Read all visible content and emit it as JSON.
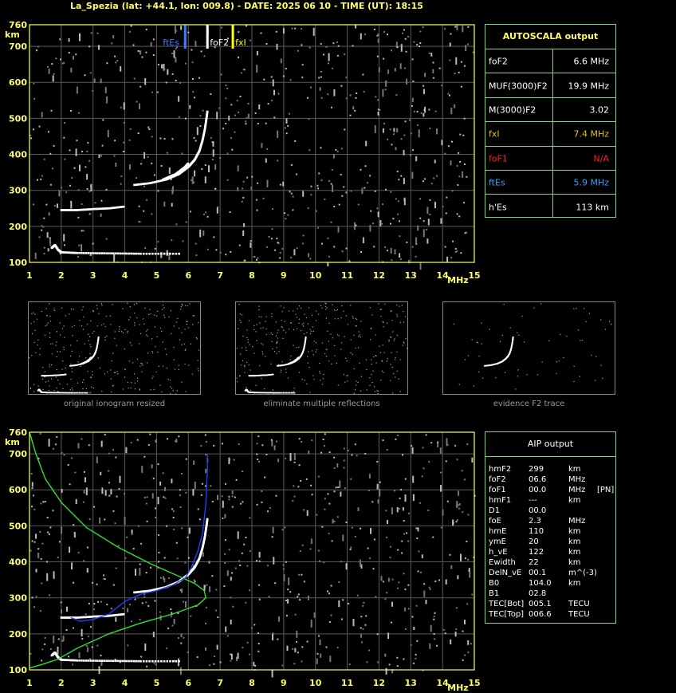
{
  "title": "La_Spezia (lat: +44.1, lon: 009.8) - DATE: 2025 06 10 - TIME (UT): 18:15",
  "colors": {
    "axis": "#ffff66",
    "grid": "#5a5a5a",
    "table_border": "#7fd37f",
    "fxI": "#ffff00",
    "ftEs": "#3a7fff",
    "foF1": "#ff2020",
    "trace": "#ffffff",
    "fit_blue": "#1f3fff",
    "fit_green": "#33dd33"
  },
  "autoscala": {
    "header": "AUTOSCALA output",
    "rows": [
      {
        "label": "foF2",
        "value": "6.6 MHz",
        "color": "#ffffff"
      },
      {
        "label": "MUF(3000)F2",
        "value": "19.9 MHz",
        "color": "#ffffff"
      },
      {
        "label": "M(3000)F2",
        "value": "3.02",
        "color": "#ffffff"
      },
      {
        "label": "fxI",
        "value": "7.4 MHz",
        "color": "#e0c020"
      },
      {
        "label": "foF1",
        "value": "N/A",
        "color": "#ff2020"
      },
      {
        "label": "ftEs",
        "value": "5.9 MHz",
        "color": "#3a9fff"
      },
      {
        "label": "h'Es",
        "value": "113    km",
        "color": "#ffffff"
      }
    ]
  },
  "chart_data": [
    {
      "type": "scatter",
      "name": "ionogram-autoscala",
      "xlim": [
        1,
        15
      ],
      "ylim": [
        100,
        760
      ],
      "x_ticks": [
        "1",
        "2",
        "3",
        "4",
        "5",
        "6",
        "7",
        "8",
        "9",
        "10",
        "11",
        "12",
        "13",
        "14",
        "15"
      ],
      "y_ticks": [
        "100",
        "200",
        "300",
        "400",
        "500",
        "600",
        "700",
        "760"
      ],
      "xunit": "MHz",
      "yunit": "km",
      "markers": [
        {
          "label": "ftEs",
          "x": 5.9,
          "color": "#3a7fff"
        },
        {
          "label": "foF2",
          "x": 6.6,
          "color": "#ffffff"
        },
        {
          "label": "fxI",
          "x": 7.4,
          "color": "#ffff00"
        }
      ],
      "traces": {
        "es_trace": [
          [
            1.7,
            140
          ],
          [
            1.8,
            148
          ],
          [
            1.9,
            135
          ],
          [
            2.0,
            128
          ],
          [
            2.5,
            126
          ],
          [
            3.5,
            125
          ],
          [
            4.5,
            124
          ],
          [
            5.8,
            124
          ]
        ],
        "es_multiple": [
          [
            2.0,
            245
          ],
          [
            2.5,
            245
          ],
          [
            3.0,
            248
          ],
          [
            3.5,
            250
          ],
          [
            4.0,
            255
          ]
        ],
        "f2_trace": [
          [
            4.3,
            315
          ],
          [
            4.8,
            320
          ],
          [
            5.3,
            330
          ],
          [
            5.7,
            345
          ],
          [
            6.0,
            365
          ],
          [
            6.2,
            385
          ],
          [
            6.35,
            410
          ],
          [
            6.45,
            440
          ],
          [
            6.52,
            470
          ],
          [
            6.57,
            500
          ],
          [
            6.6,
            520
          ]
        ],
        "f2_x_trace": [
          [
            5.2,
            330
          ],
          [
            5.6,
            345
          ],
          [
            5.9,
            365
          ],
          [
            6.0,
            375
          ]
        ]
      }
    },
    {
      "type": "line",
      "name": "ionogram-aip",
      "xlim": [
        1,
        15
      ],
      "ylim": [
        100,
        760
      ],
      "x_ticks": [
        "1",
        "2",
        "3",
        "4",
        "5",
        "6",
        "7",
        "8",
        "9",
        "10",
        "11",
        "12",
        "13",
        "14",
        "15"
      ],
      "y_ticks": [
        "100",
        "200",
        "300",
        "400",
        "500",
        "600",
        "700",
        "760"
      ],
      "xunit": "MHz",
      "yunit": "km",
      "series": [
        {
          "color": "#33dd33",
          "points": [
            [
              1,
              760
            ],
            [
              1.2,
              700
            ],
            [
              1.5,
              630
            ],
            [
              2.0,
              565
            ],
            [
              2.8,
              495
            ],
            [
              3.8,
              440
            ],
            [
              4.8,
              395
            ],
            [
              5.7,
              360
            ],
            [
              6.2,
              340
            ],
            [
              6.5,
              320
            ],
            [
              6.55,
              300
            ],
            [
              6.3,
              280
            ],
            [
              5.5,
              255
            ],
            [
              4.5,
              230
            ],
            [
              3.5,
              200
            ],
            [
              2.5,
              160
            ],
            [
              1.9,
              130
            ],
            [
              1.4,
              115
            ],
            [
              1,
              105
            ]
          ]
        },
        {
          "color": "#1f3fff",
          "points": [
            [
              2.3,
              245
            ],
            [
              2.6,
              235
            ],
            [
              3.0,
              240
            ],
            [
              3.5,
              255
            ],
            [
              4.0,
              290
            ],
            [
              4.5,
              310
            ],
            [
              5.0,
              320
            ],
            [
              5.5,
              335
            ],
            [
              5.9,
              355
            ],
            [
              6.1,
              385
            ],
            [
              6.3,
              430
            ],
            [
              6.45,
              480
            ],
            [
              6.55,
              560
            ],
            [
              6.6,
              660
            ],
            [
              6.6,
              700
            ]
          ]
        }
      ],
      "traces": {
        "es_trace": [
          [
            1.7,
            140
          ],
          [
            1.8,
            148
          ],
          [
            1.9,
            135
          ],
          [
            2.0,
            128
          ],
          [
            2.5,
            126
          ],
          [
            3.5,
            125
          ],
          [
            4.5,
            124
          ],
          [
            5.8,
            124
          ]
        ],
        "es_multiple": [
          [
            2.0,
            245
          ],
          [
            2.5,
            245
          ],
          [
            3.0,
            248
          ],
          [
            3.5,
            250
          ],
          [
            4.0,
            255
          ]
        ],
        "f2_trace": [
          [
            4.3,
            315
          ],
          [
            4.8,
            320
          ],
          [
            5.3,
            330
          ],
          [
            5.7,
            345
          ],
          [
            6.0,
            365
          ],
          [
            6.2,
            385
          ],
          [
            6.35,
            410
          ],
          [
            6.45,
            440
          ],
          [
            6.52,
            470
          ],
          [
            6.57,
            500
          ],
          [
            6.6,
            520
          ]
        ]
      }
    }
  ],
  "thumbnails": [
    {
      "caption": "original ionogram resized"
    },
    {
      "caption": "eliminate multiple reflections"
    },
    {
      "caption": "evidence F2 trace"
    }
  ],
  "aip": {
    "header": "AIP output",
    "rows": [
      [
        "hmF2",
        "299",
        "km",
        ""
      ],
      [
        "foF2",
        "06.6",
        "MHz",
        ""
      ],
      [
        "foF1",
        "00.0",
        "MHz",
        "[PN]"
      ],
      [
        "hmF1",
        "---",
        "km",
        ""
      ],
      [
        "D1",
        "00.0",
        "",
        ""
      ],
      [
        "foE",
        "2.3",
        "MHz",
        ""
      ],
      [
        "hmE",
        "110",
        "km",
        ""
      ],
      [
        "ymE",
        "20",
        "km",
        ""
      ],
      [
        "h_vE",
        "122",
        "km",
        ""
      ],
      [
        "Ewidth",
        "22",
        "km",
        ""
      ],
      [
        "DelN_vE",
        "00.1",
        "m^(-3)",
        ""
      ],
      [
        "B0",
        "104.0",
        "km",
        ""
      ],
      [
        "B1",
        "02.8",
        "",
        ""
      ],
      [
        "TEC[Bot]",
        "005.1",
        "TECU",
        ""
      ],
      [
        "TEC[Top]",
        "006.6",
        "TECU",
        ""
      ]
    ]
  }
}
